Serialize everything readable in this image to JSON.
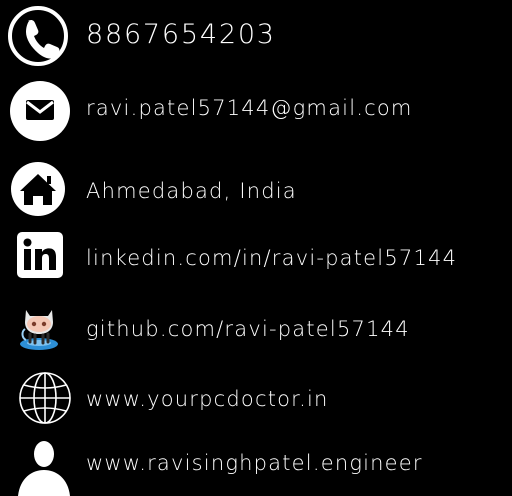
{
  "contact": {
    "phone": "8867654203",
    "email": "ravi.patel57144@gmail.com",
    "location": "Ahmedabad, India",
    "linkedin": "linkedin.com/in/ravi-patel57144",
    "github": "github.com/ravi-patel57144",
    "website": "www.yourpcdoctor.in",
    "portfolio": "www.ravisinghpatel.engineer"
  },
  "icons": {
    "phone": "phone-icon",
    "email": "envelope-icon",
    "location": "home-icon",
    "linkedin": "linkedin-icon",
    "github": "octocat-icon",
    "website": "globe-icon",
    "portfolio": "person-icon"
  },
  "colors": {
    "background": "#000000",
    "text": "#ffffff",
    "octocat_blue": "#2d8fd6"
  }
}
